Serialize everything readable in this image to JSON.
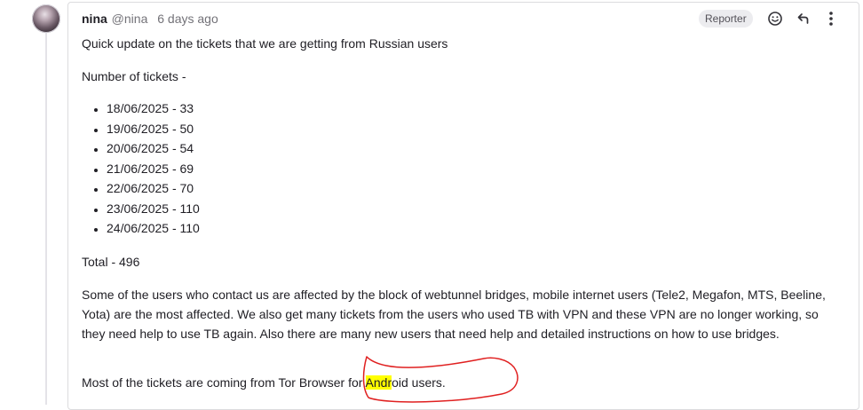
{
  "comment": {
    "author": "nina",
    "handle": "@nina",
    "time": "6 days ago",
    "role_badge": "Reporter",
    "actions": {
      "reaction_icon": "smiley-icon",
      "reply_icon": "reply-arrow-icon",
      "more_icon": "vertical-ellipsis-icon"
    },
    "body": {
      "intro": "Quick update on the tickets that we are getting from Russian users",
      "count_heading": "Number of tickets -",
      "ticket_list": [
        "18/06/2025 - 33",
        "19/06/2025 - 50",
        "20/06/2025 - 54",
        "21/06/2025 - 69",
        "22/06/2025 - 70",
        "23/06/2025 - 110",
        "24/06/2025 - 110"
      ],
      "total": "Total - 496",
      "paragraph": "Some of the users who contact us are affected by the block of webtunnel bridges, mobile internet users (Tele2, Megafon, MTS, Beeline, Yota) are the most affected. We also get many tickets from the users who used TB with VPN and these VPN are no longer working, so they need help to use TB again. Also there are many new users that need help and detailed instructions on how to use bridges.",
      "last_before": "Most of the tickets are coming from Tor Browser for ",
      "last_highlight": "Andr",
      "last_after": "oid users."
    }
  },
  "colors": {
    "highlight": "#ffff00",
    "annotation_stroke": "#e02020",
    "muted_text": "#737278",
    "badge_bg": "#ececef"
  }
}
